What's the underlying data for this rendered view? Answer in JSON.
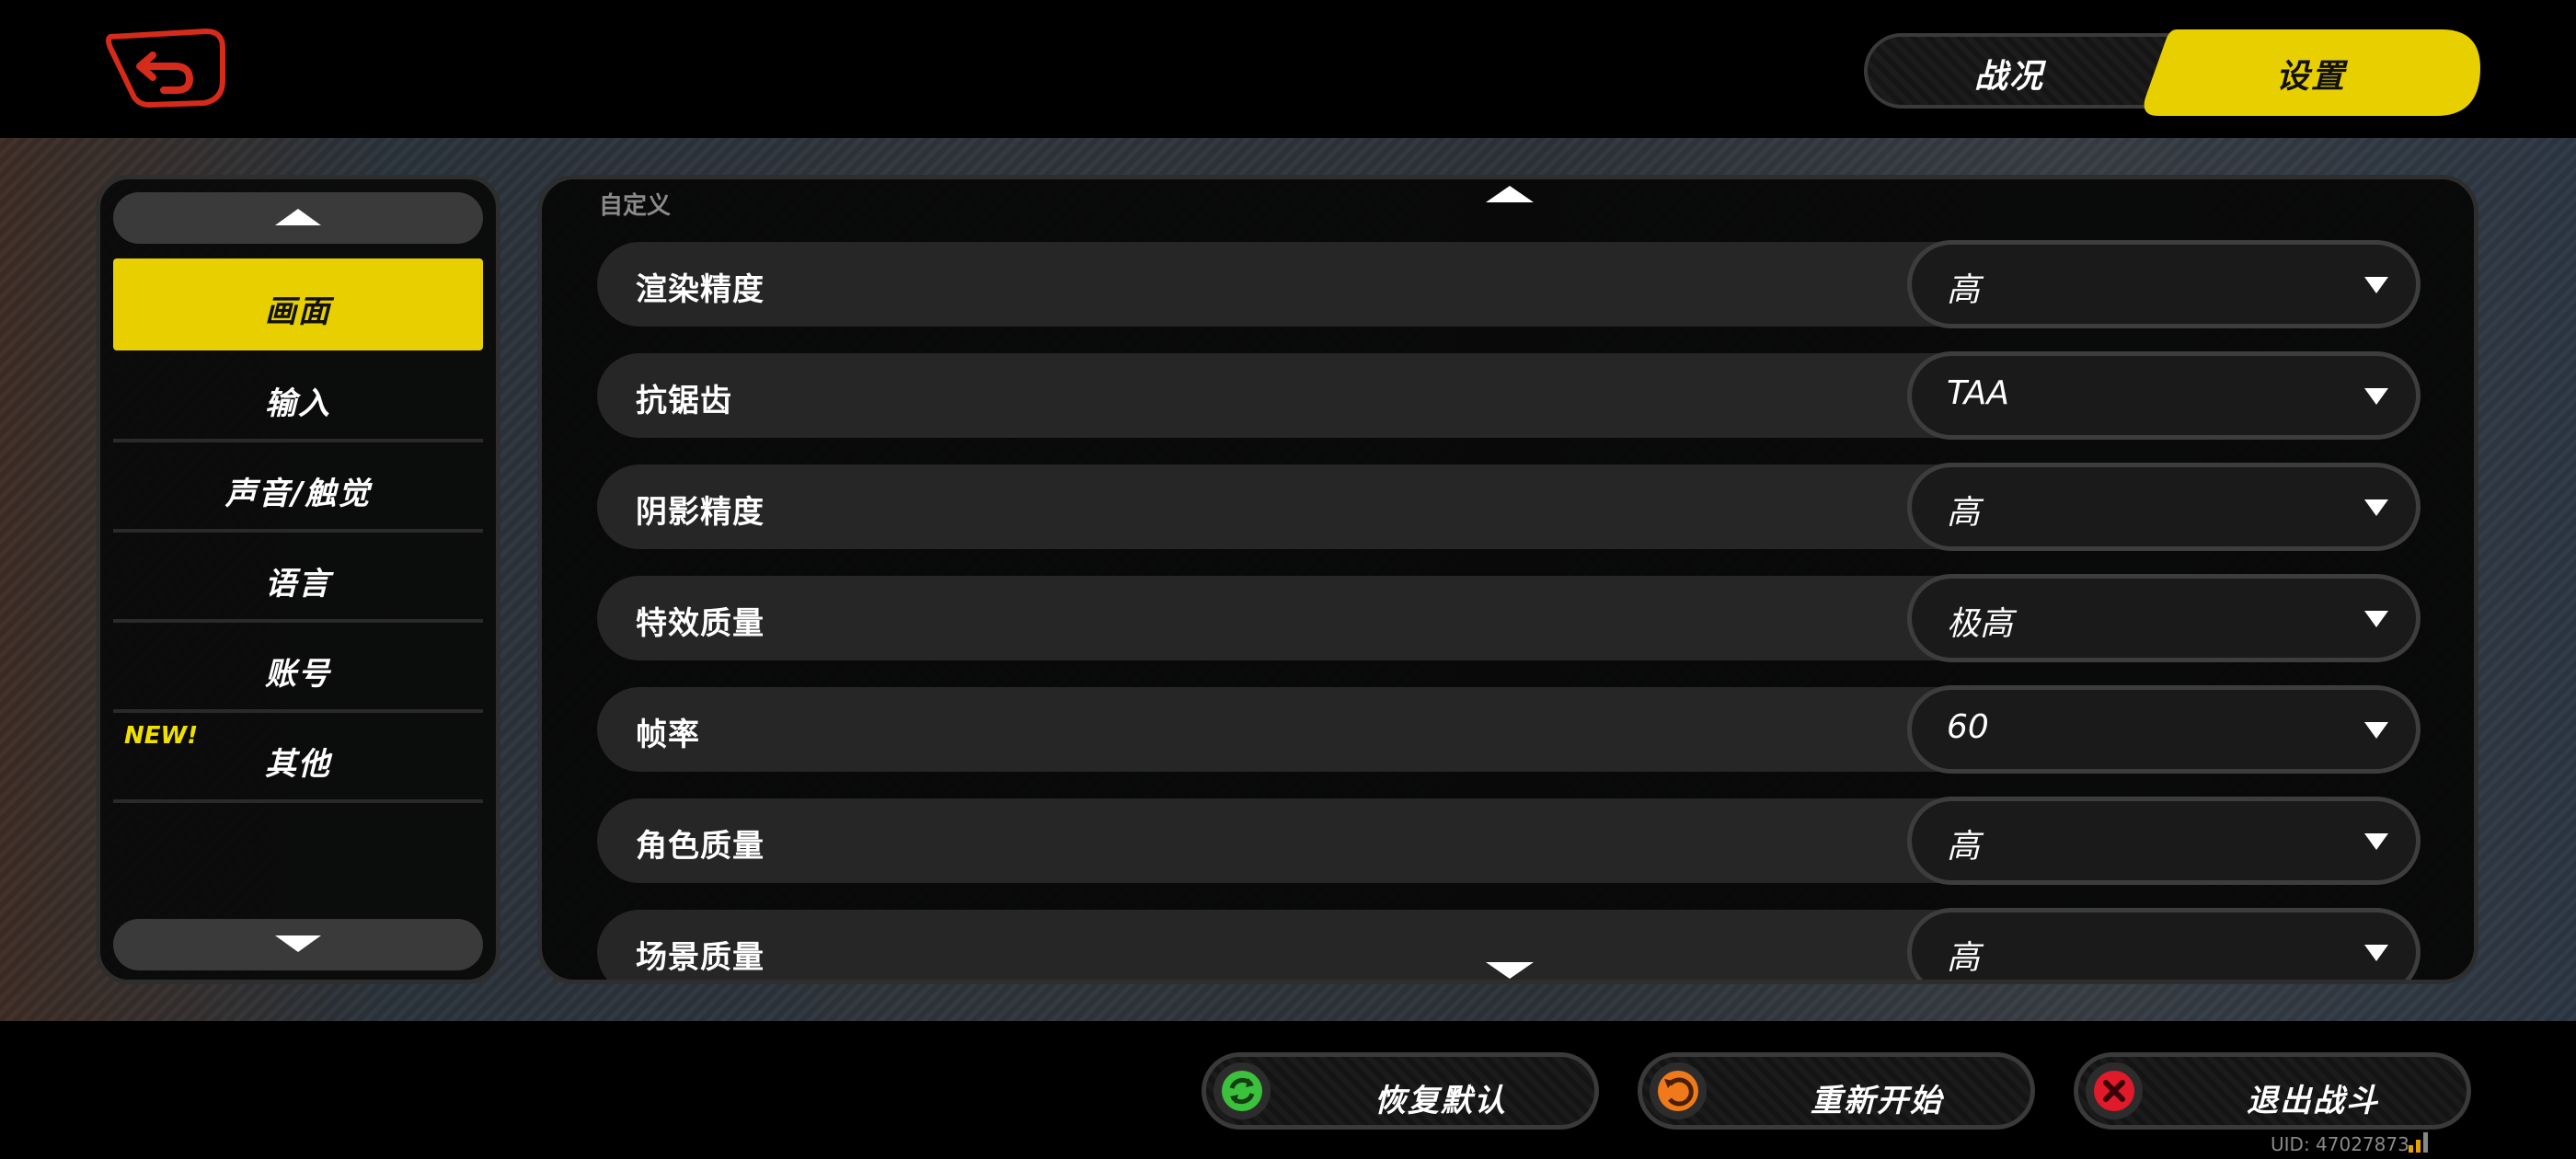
{
  "header": {
    "tabs": [
      {
        "label": "战况",
        "active": false
      },
      {
        "label": "设置",
        "active": true
      }
    ]
  },
  "sidebar": {
    "items": [
      {
        "label": "画面",
        "active": true
      },
      {
        "label": "输入"
      },
      {
        "label": "声音/触觉"
      },
      {
        "label": "语言"
      },
      {
        "label": "账号"
      },
      {
        "label": "其他",
        "badge": "NEW!"
      }
    ]
  },
  "main": {
    "section_label": "自定义",
    "settings": [
      {
        "label": "渲染精度",
        "value": "高"
      },
      {
        "label": "抗锯齿",
        "value": "TAA"
      },
      {
        "label": "阴影精度",
        "value": "高"
      },
      {
        "label": "特效质量",
        "value": "极高"
      },
      {
        "label": "帧率",
        "value": "60"
      },
      {
        "label": "角色质量",
        "value": "高"
      },
      {
        "label": "场景质量",
        "value": "高"
      }
    ]
  },
  "actions": {
    "restore": "恢复默认",
    "restart": "重新开始",
    "exit": "退出战斗"
  },
  "footer": {
    "uid": "UID: 47027873"
  },
  "colors": {
    "accent_yellow": "#e8d000",
    "back_red": "#d62a1a",
    "restore_green": "#3cc13c",
    "restart_orange": "#f07a1a",
    "exit_red": "#e01a2a"
  },
  "icons": {
    "back": "back-arrow-icon",
    "restore": "refresh-icon",
    "restart": "undo-icon",
    "exit": "close-icon"
  }
}
